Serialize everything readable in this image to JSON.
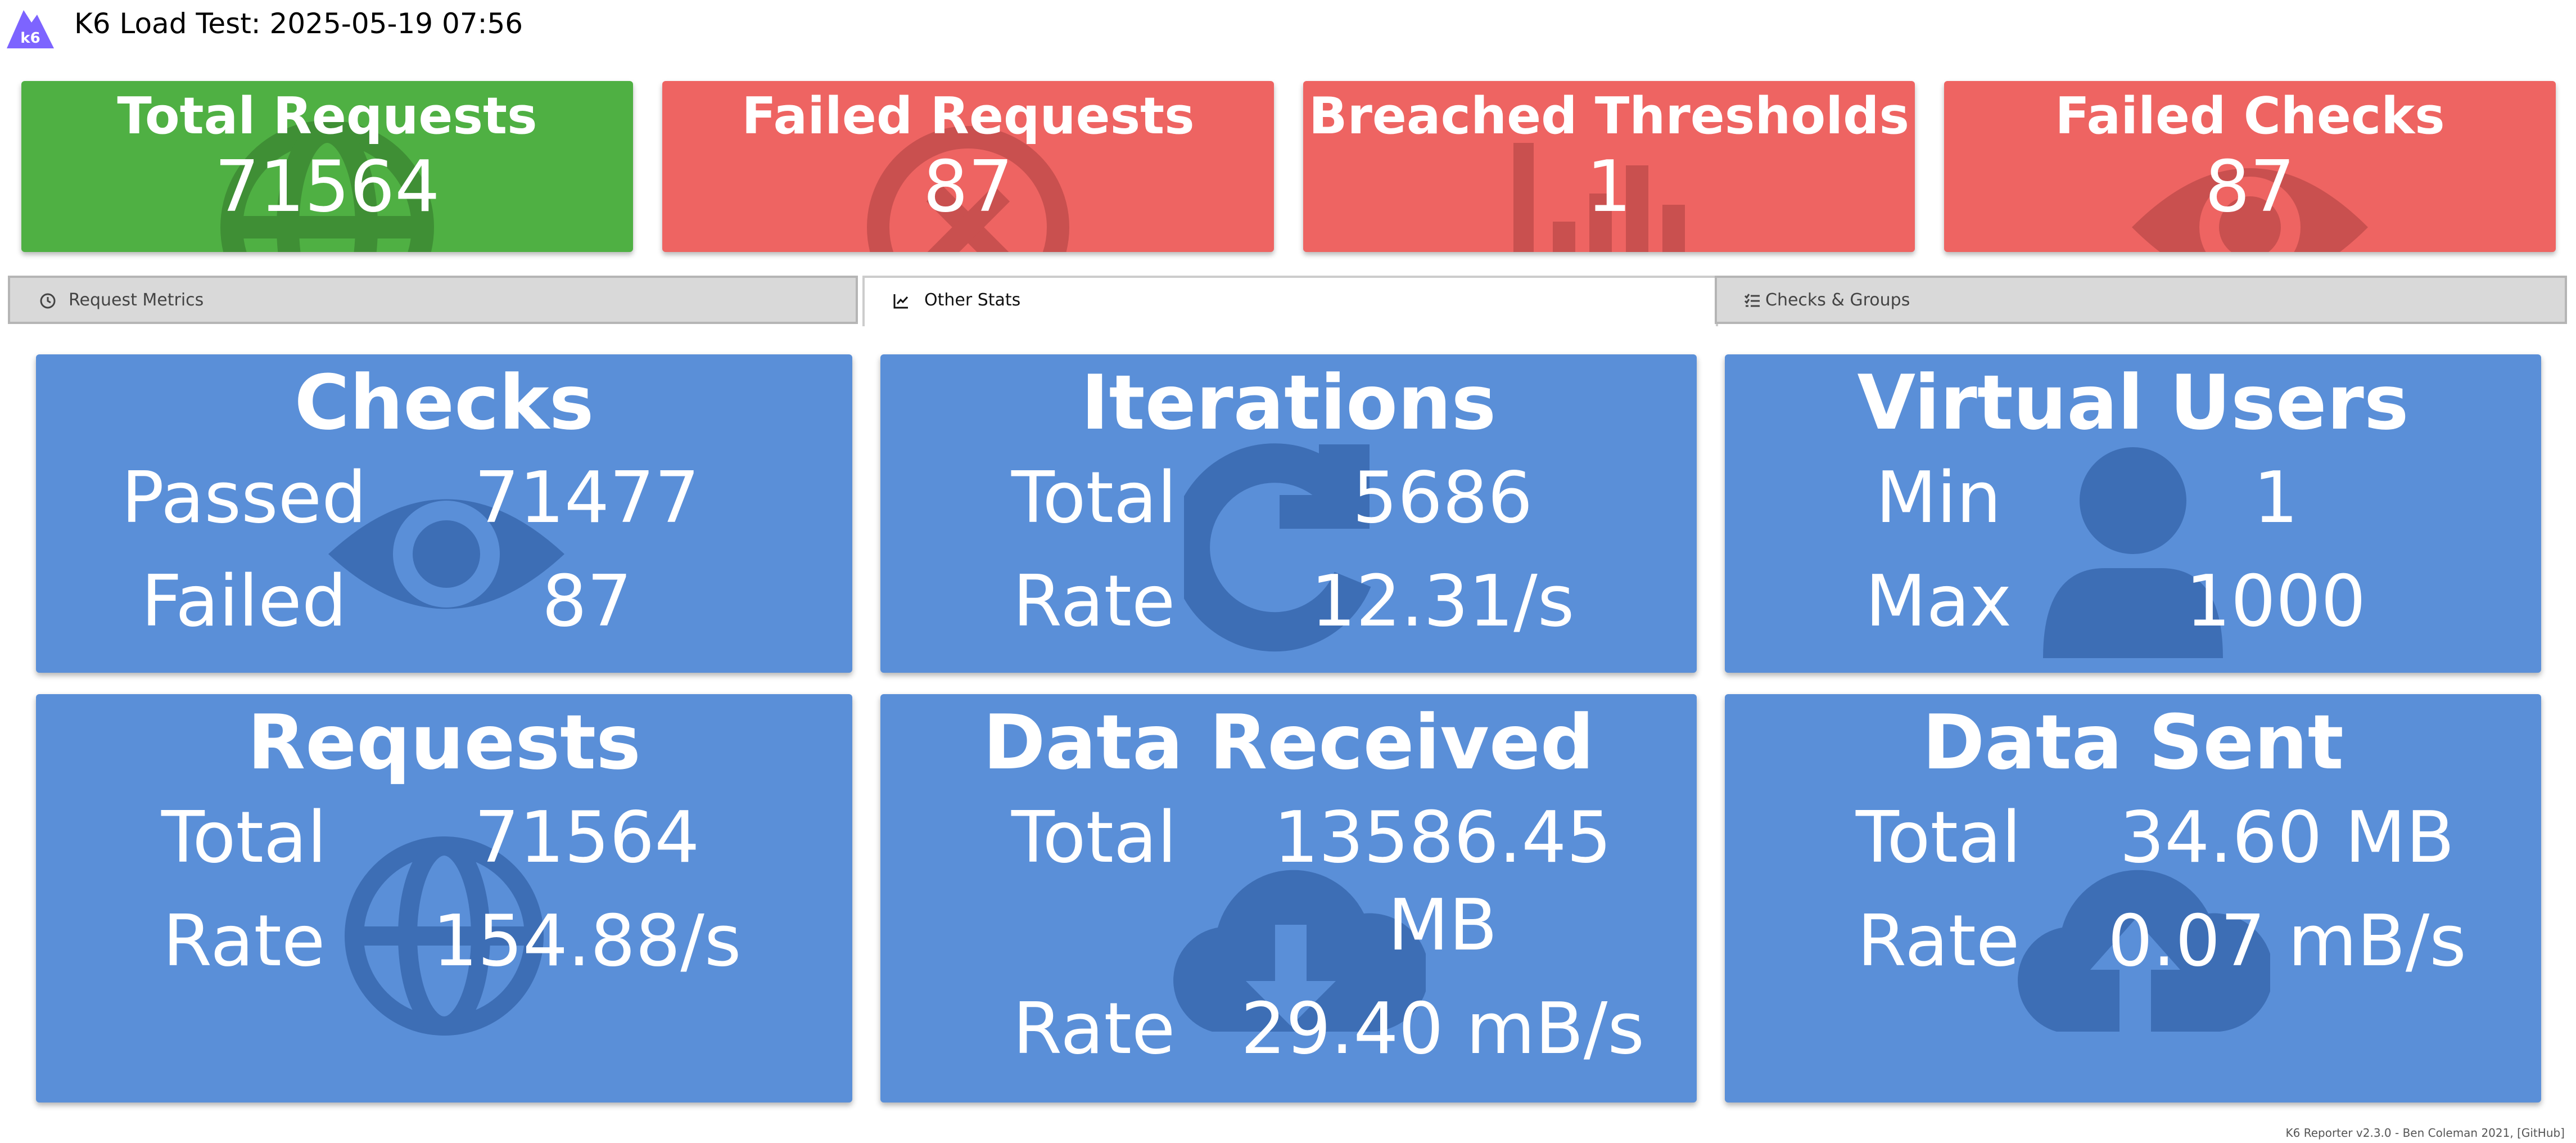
{
  "header": {
    "title": "K6 Load Test: 2025-05-19 07:56",
    "logo_text": "k6"
  },
  "summary": [
    {
      "title": "Total Requests",
      "value": "71564",
      "icon": "globe-icon"
    },
    {
      "title": "Failed Requests",
      "value": "87",
      "icon": "x-circle-icon"
    },
    {
      "title": "Breached Thresholds",
      "value": "1",
      "icon": "bar-chart-icon"
    },
    {
      "title": "Failed Checks",
      "value": "87",
      "icon": "eye-icon"
    }
  ],
  "tabs": [
    {
      "label": "Request Metrics",
      "icon": "clock-icon",
      "active": false
    },
    {
      "label": "Other Stats",
      "icon": "line-chart-icon",
      "active": true
    },
    {
      "label": "Checks & Groups",
      "icon": "checklist-icon",
      "active": false
    }
  ],
  "cards": {
    "checks": {
      "title": "Checks",
      "label1": "Passed",
      "value1": "71477",
      "label2": "Failed",
      "value2": "87",
      "icon": "eye-icon"
    },
    "iterations": {
      "title": "Iterations",
      "label1": "Total",
      "value1": "5686",
      "label2": "Rate",
      "value2": "12.31/s",
      "icon": "redo-icon"
    },
    "vus": {
      "title": "Virtual Users",
      "label1": "Min",
      "value1": "1",
      "label2": "Max",
      "value2": "1000",
      "icon": "user-icon"
    },
    "requests": {
      "title": "Requests",
      "label1": "Total",
      "value1": "71564",
      "label2": "Rate",
      "value2": "154.88/s",
      "icon": "globe-icon"
    },
    "data_received": {
      "title": "Data Received",
      "label1": "Total",
      "value1a": "13586.45",
      "value1b": "MB",
      "label2": "Rate",
      "value2": "29.40 mB/s",
      "icon": "cloud-download-icon"
    },
    "data_sent": {
      "title": "Data Sent",
      "label1": "Total",
      "value1": "34.60 MB",
      "label2": "Rate",
      "value2": "0.07 mB/s",
      "icon": "cloud-upload-icon"
    }
  },
  "footer": "K6 Reporter v2.3.0 - Ben Coleman 2021, [GitHub]",
  "colors": {
    "green": "#4fb043",
    "red": "#ee6462",
    "card_blue": "#5a8fd8",
    "icon_overlay": "#3d6eb5"
  }
}
